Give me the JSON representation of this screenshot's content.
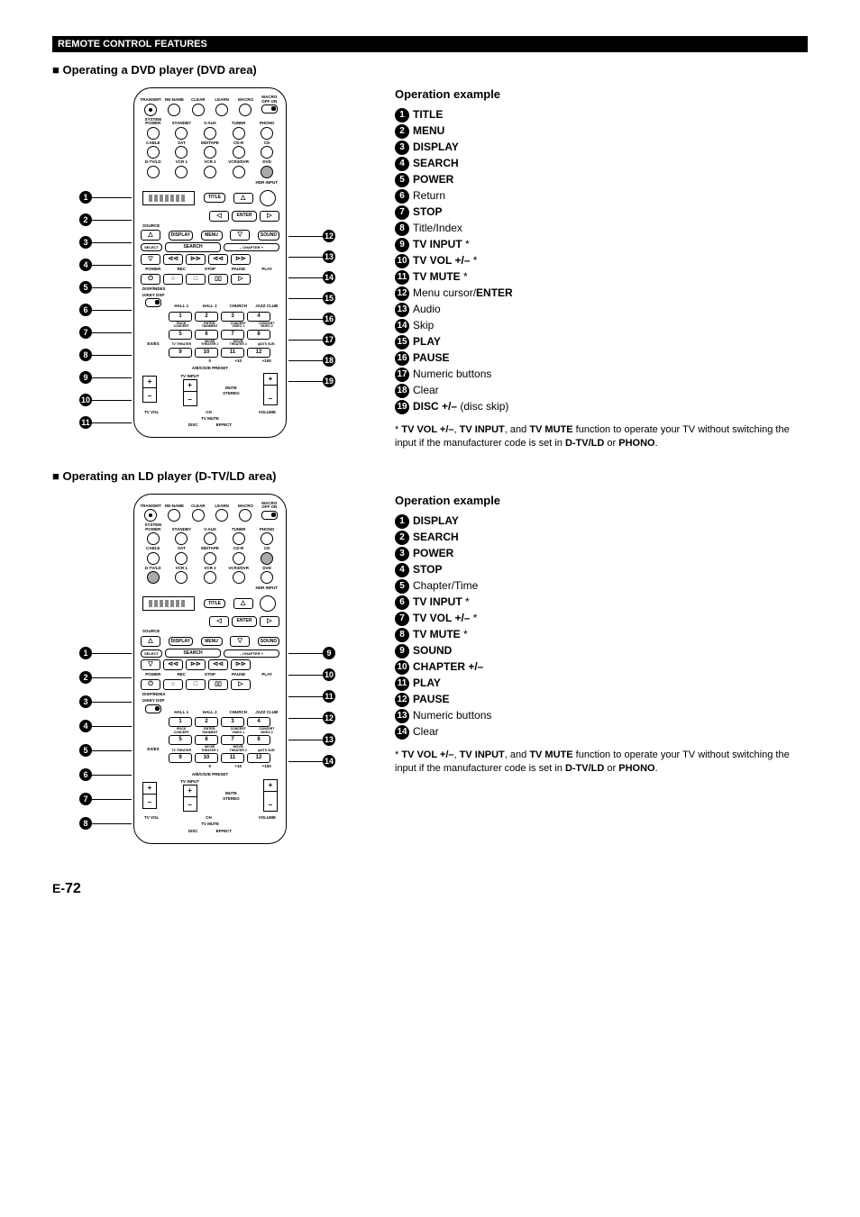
{
  "header": "REMOTE CONTROL FEATURES",
  "section1": {
    "title": "Operating a DVD player (DVD area)",
    "ops_heading": "Operation example",
    "items": [
      {
        "n": "1",
        "label": "TITLE",
        "bold": true
      },
      {
        "n": "2",
        "label": "MENU",
        "bold": true
      },
      {
        "n": "3",
        "label": "DISPLAY",
        "bold": true
      },
      {
        "n": "4",
        "label": "SEARCH",
        "bold": true
      },
      {
        "n": "5",
        "label": "POWER",
        "bold": true
      },
      {
        "n": "6",
        "label": "Return",
        "bold": false
      },
      {
        "n": "7",
        "label": "STOP",
        "bold": true
      },
      {
        "n": "8",
        "label": "Title/Index",
        "bold": false
      },
      {
        "n": "9",
        "label": "TV INPUT",
        "bold": true,
        "star": true
      },
      {
        "n": "10",
        "label": "TV VOL +/–",
        "bold": true,
        "star": true
      },
      {
        "n": "11",
        "label": "TV MUTE",
        "bold": true,
        "star": true
      },
      {
        "n": "12",
        "label_pre": "Menu cursor/",
        "label": "ENTER",
        "bold": true
      },
      {
        "n": "13",
        "label": "Audio",
        "bold": false
      },
      {
        "n": "14",
        "label": "Skip",
        "bold": false
      },
      {
        "n": "15",
        "label": "PLAY",
        "bold": true
      },
      {
        "n": "16",
        "label": "PAUSE",
        "bold": true
      },
      {
        "n": "17",
        "label": "Numeric buttons",
        "bold": false
      },
      {
        "n": "18",
        "label": "Clear",
        "bold": false
      },
      {
        "n": "19",
        "label": "DISC +/–",
        "bold": true,
        "suffix": " (disc skip)"
      }
    ],
    "left_callouts": [
      "1",
      "2",
      "3",
      "4",
      "5",
      "6",
      "7",
      "8",
      "9",
      "10",
      "11"
    ],
    "right_callouts": [
      "12",
      "13",
      "14",
      "15",
      "16",
      "17",
      "18",
      "19"
    ]
  },
  "section2": {
    "title": "Operating an LD player (D-TV/LD area)",
    "ops_heading": "Operation example",
    "items": [
      {
        "n": "1",
        "label": "DISPLAY",
        "bold": true
      },
      {
        "n": "2",
        "label": "SEARCH",
        "bold": true
      },
      {
        "n": "3",
        "label": "POWER",
        "bold": true
      },
      {
        "n": "4",
        "label": "STOP",
        "bold": true
      },
      {
        "n": "5",
        "label": "Chapter/Time",
        "bold": false
      },
      {
        "n": "6",
        "label": "TV INPUT",
        "bold": true,
        "star": true
      },
      {
        "n": "7",
        "label": "TV VOL +/–",
        "bold": true,
        "star": true
      },
      {
        "n": "8",
        "label": "TV MUTE",
        "bold": true,
        "star": true
      },
      {
        "n": "9",
        "label": "SOUND",
        "bold": true
      },
      {
        "n": "10",
        "label": "CHAPTER +/–",
        "bold": true
      },
      {
        "n": "11",
        "label": "PLAY",
        "bold": true
      },
      {
        "n": "12",
        "label": "PAUSE",
        "bold": true
      },
      {
        "n": "13",
        "label": "Numeric buttons",
        "bold": false
      },
      {
        "n": "14",
        "label": "Clear",
        "bold": false
      }
    ],
    "left_callouts": [
      "1",
      "2",
      "3",
      "4",
      "5",
      "6",
      "7",
      "8"
    ],
    "right_callouts": [
      "9",
      "10",
      "11",
      "12",
      "13",
      "14"
    ]
  },
  "footnote": {
    "pre": "* ",
    "b1": "TV VOL +/–",
    "sep1": ", ",
    "b2": "TV INPUT",
    "sep2": ", and ",
    "b3": "TV MUTE",
    "mid": " function to operate your TV without switching the input if the manufacturer code is set in ",
    "b4": "D-TV/LD",
    "or": " or ",
    "b5": "PHONO",
    "end": "."
  },
  "remote": {
    "row_top": [
      "TRANSMIT",
      "RE-NAME",
      "CLEAR",
      "LEARN",
      "MACRO",
      "MACRO OFF  ON"
    ],
    "row2": [
      "SYSTEM POWER",
      "STANDBY",
      "V-AUX",
      "TUNER",
      "PHONO"
    ],
    "row3": [
      "CABLE",
      "SAT",
      "MD/TAPE",
      "CD-R",
      "CD"
    ],
    "row4": [
      "D-TV/LD",
      "VCR 1",
      "VCR 2",
      "VCR3/DVR",
      "DVD"
    ],
    "title": "TITLE",
    "enter": "ENTER",
    "source": "SOURCE",
    "display": "DISPLAY",
    "menu": "MENU",
    "sound": "SOUND",
    "select": "SELECT",
    "search": "SEARCH",
    "chapter_minus": "–  CHAPTER  +",
    "power": "POWER",
    "rec": "REC",
    "stop": "STOP",
    "pause": "PAUSE",
    "play": "PLAY",
    "dsp": "10KEY   DSP",
    "halls": [
      "HALL 1",
      "HALL 2",
      "CHURCH",
      "JAZZ CLUB"
    ],
    "nums1": [
      "1",
      "2",
      "3",
      "4"
    ],
    "row_lbl2": [
      "ROCK CONCERT",
      "ENTER-TAINMENT",
      "CONCERT VIDEO 1",
      "CONCERT VIDEO 2"
    ],
    "nums2": [
      "5",
      "6",
      "7",
      "8"
    ],
    "row_lbl3": [
      "TV THEATER",
      "MOVIE THEATER 1",
      "MOVIE THEATER 2",
      "q/DTS SUR."
    ],
    "ex": "EX/ES",
    "nums3": [
      "9",
      "10",
      "11",
      "12"
    ],
    "row_lbl4": [
      "",
      "0",
      "+10",
      "+100"
    ],
    "preset": "A/B/C/D/E   PRESET",
    "tvinput": "TV INPUT",
    "tvvol": "TV VOL",
    "tvmute": "TV MUTE",
    "ch": "CH",
    "mute": "MUTE",
    "stereo": "STEREO",
    "volume": "VOLUME",
    "disc": "DISC",
    "effect": "EFFECT",
    "hdr_input": "HDR INPUT",
    "disp_index": "DISP/INDEX"
  },
  "page": {
    "prefix": "E-",
    "num": "72"
  }
}
